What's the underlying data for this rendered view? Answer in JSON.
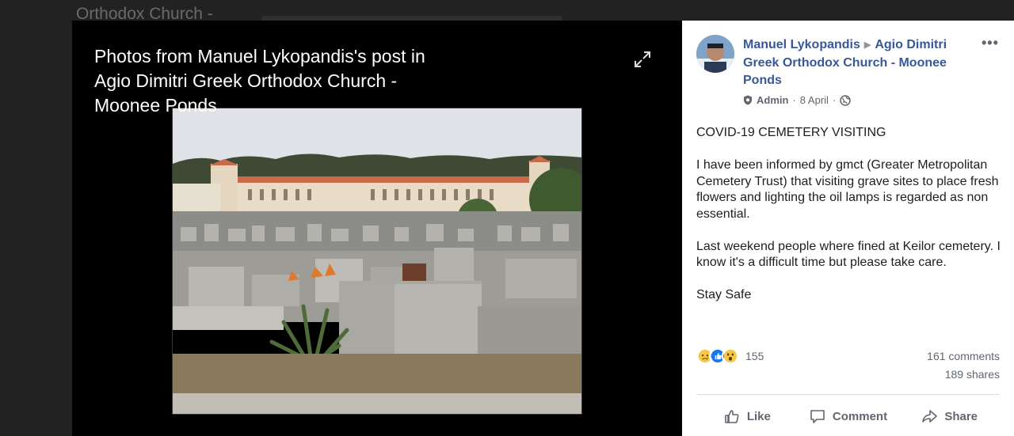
{
  "background": {
    "partial_text": "Orthodox Church -"
  },
  "viewer": {
    "title": "Photos from Manuel Lykopandis's post in Agio Dimitri Greek Orthodox Church - Moonee Ponds",
    "expand_icon": "expand-icon"
  },
  "post": {
    "author": "Manuel Lykopandis",
    "group": "Agio Dimitri Greek Orthodox Church - Moonee Ponds",
    "role": "Admin",
    "date": "8 April",
    "more_label": "•••",
    "paragraphs": [
      "COVID-19 CEMETERY VISITING",
      "I have been informed by gmct (Greater Metropolitan Cemetery Trust) that visiting grave sites to place fresh flowers and lighting the oil lamps is regarded as non essential.",
      "Last weekend people where fined at Keilor cemetery. I know it's a difficult time but please take care.",
      "Stay Safe"
    ],
    "reaction_count": "155",
    "comments": "161 comments",
    "shares": "189 shares",
    "actions": {
      "like": "Like",
      "comment": "Comment",
      "share": "Share"
    }
  },
  "colors": {
    "link_blue": "#385898",
    "muted": "#606770",
    "like_blue": "#1877f2",
    "emoji_yellow": "#f7c843"
  }
}
